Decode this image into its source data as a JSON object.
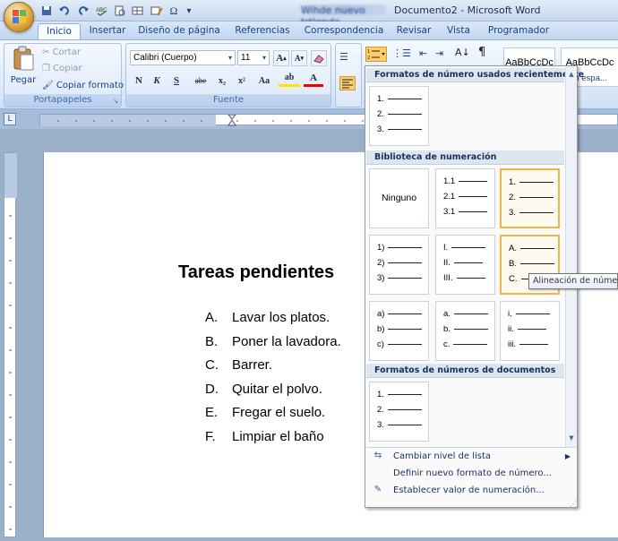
{
  "window": {
    "title_blurred": "Wihde nuevo trtlendo",
    "title": "Documento2 - Microsoft Word"
  },
  "qat": [
    "save-icon",
    "undo-icon",
    "redo-icon",
    "spelling-icon",
    "print-preview-icon",
    "insert-table-icon",
    "draw-table-icon",
    "symbol-icon",
    "customize-icon"
  ],
  "tabs": [
    "Inicio",
    "Insertar",
    "Diseño de página",
    "Referencias",
    "Correspondencia",
    "Revisar",
    "Vista",
    "Programador"
  ],
  "ribbon": {
    "portapapeles": {
      "paste": "Pegar",
      "cut": "Cortar",
      "copy": "Copiar",
      "format_painter": "Copiar formato",
      "label": "Portapapeles"
    },
    "fuente": {
      "font_name": "Calibri (Cuerpo)",
      "font_size": "11",
      "label": "Fuente",
      "grow": "A",
      "shrink": "A",
      "bold": "N",
      "italic": "K",
      "underline": "S",
      "strike": "abe",
      "subscript": "x₂",
      "superscript": "x²",
      "case": "Aa",
      "highlight": "ab",
      "font_color": "A"
    },
    "styles": {
      "normal": "AaBbCcDc",
      "no_spacing": "AaBbCcDc",
      "no_spacing_label": "in espa..."
    }
  },
  "document": {
    "title": "Tareas pendientes",
    "items": [
      {
        "marker": "A.",
        "text": "Lavar los platos."
      },
      {
        "marker": "B.",
        "text": "Poner la lavadora."
      },
      {
        "marker": "C.",
        "text": "Barrer."
      },
      {
        "marker": "D.",
        "text": "Quitar el polvo."
      },
      {
        "marker": "E.",
        "text": "Fregar el suelo."
      },
      {
        "marker": "F.",
        "text": "Limpiar el baño"
      }
    ]
  },
  "menu": {
    "recent_header": "Formatos de número usados recientemente",
    "library_header": "Biblioteca de numeración",
    "doc_header": "Formatos de números de documentos",
    "none_label": "Ninguno",
    "recent": [
      [
        "1.",
        "2.",
        "3."
      ]
    ],
    "library": [
      [
        "1.1",
        "2.1",
        "3.1"
      ],
      [
        "1.",
        "2.",
        "3."
      ],
      [
        "1)",
        "2)",
        "3)"
      ],
      [
        "I.",
        "II.",
        "III."
      ],
      [
        "A.",
        "B.",
        "C."
      ],
      [
        "a)",
        "b)",
        "c)"
      ],
      [
        "a.",
        "b.",
        "c."
      ],
      [
        "i.",
        "ii.",
        "iii."
      ]
    ],
    "document_formats": [
      [
        "1.",
        "2.",
        "3."
      ]
    ],
    "items": [
      {
        "label": "Cambiar nivel de lista"
      },
      {
        "label": "Definir nuevo formato de número..."
      },
      {
        "label": "Establecer valor de numeración..."
      }
    ]
  },
  "tooltip": "Alineación de número"
}
